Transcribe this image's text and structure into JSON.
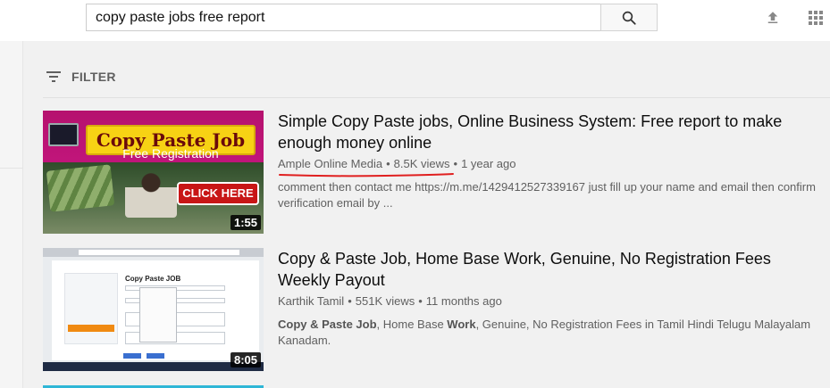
{
  "search": {
    "query": "copy paste jobs free report"
  },
  "header": {
    "icons": [
      "search-icon",
      "upload-icon",
      "apps-grid-icon"
    ]
  },
  "filter": {
    "label": "FILTER",
    "icon": "filter-icon"
  },
  "results": [
    {
      "title": "Simple Copy Paste jobs, Online Business System: Free report to make enough money online",
      "channel": "Ample Online Media",
      "views": "8.5K views",
      "age": "1 year ago",
      "description": "comment then contact me https://m.me/1429412527339167 just fill up your name and email then confirm verification email by ...",
      "duration": "1:55",
      "thumb": {
        "banner": "Copy Paste Job",
        "subtitle": "Free Registration",
        "cta": "CLICK HERE"
      }
    },
    {
      "title": "Copy & Paste Job, Home Base Work, Genuine, No Registration Fees Weekly Payout",
      "channel": "Karthik Tamil",
      "views": "551K views",
      "age": "11 months ago",
      "description_parts": {
        "b1": "Copy & Paste Job",
        "t1": ", Home Base ",
        "b2": "Work",
        "t2": ", Genuine, No Registration Fees in Tamil Hindi Telugu Malayalam Kanadam."
      },
      "duration": "8:05",
      "thumb": {
        "form_title": "Copy Paste JOB"
      }
    }
  ],
  "separator": "•",
  "colors": {
    "annotation_underline": "#e02020"
  }
}
